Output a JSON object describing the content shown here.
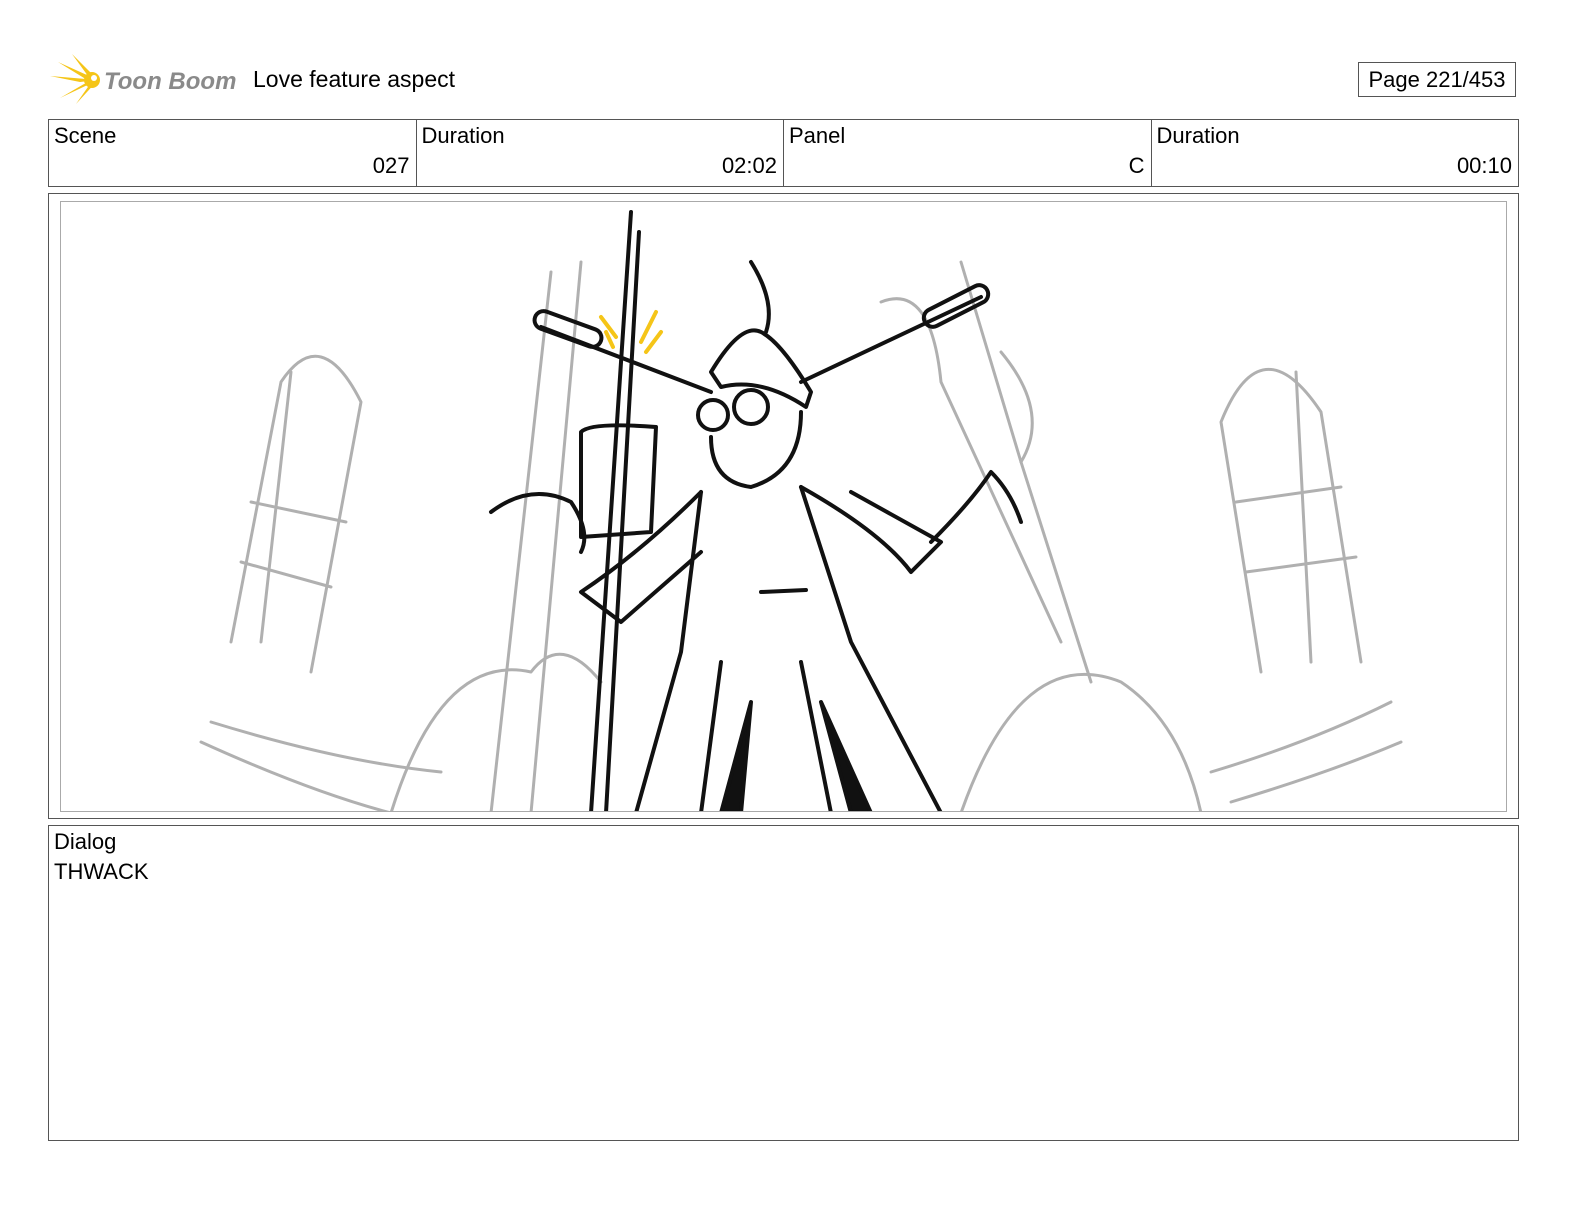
{
  "header": {
    "logo_text": "Toon Boom",
    "project_title": "Love feature aspect",
    "page_label": "Page 221/453"
  },
  "info": [
    {
      "label": "Scene",
      "value": "027"
    },
    {
      "label": "Duration",
      "value": "02:02"
    },
    {
      "label": "Panel",
      "value": "C"
    },
    {
      "label": "Duration",
      "value": "00:10"
    }
  ],
  "dialog": {
    "label": "Dialog",
    "text": "THWACK"
  },
  "colors": {
    "logo_accent": "#f5c518",
    "logo_text": "#8a8a8a",
    "sketch": "#111111",
    "background_sketch": "#b0b0b0"
  }
}
